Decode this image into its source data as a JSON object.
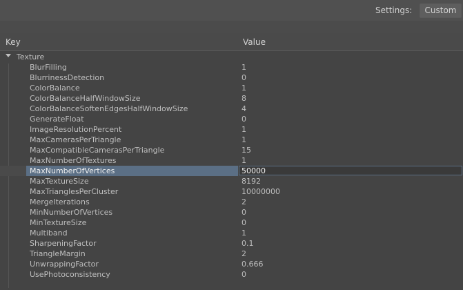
{
  "settings": {
    "label": "Settings:",
    "value": "Custom"
  },
  "columns": {
    "key": "Key",
    "value": "Value"
  },
  "group": {
    "label": "Texture"
  },
  "rows": [
    {
      "key": "BlurFilling",
      "value": "1"
    },
    {
      "key": "BlurrinessDetection",
      "value": "0"
    },
    {
      "key": "ColorBalance",
      "value": "1"
    },
    {
      "key": "ColorBalanceHalfWindowSize",
      "value": "8"
    },
    {
      "key": "ColorBalanceSoftenEdgesHalfWindowSize",
      "value": "4"
    },
    {
      "key": "GenerateFloat",
      "value": "0"
    },
    {
      "key": "ImageResolutionPercent",
      "value": "1"
    },
    {
      "key": "MaxCamerasPerTriangle",
      "value": "1"
    },
    {
      "key": "MaxCompatibleCamerasPerTriangle",
      "value": "15"
    },
    {
      "key": "MaxNumberOfTextures",
      "value": "1"
    },
    {
      "key": "MaxNumberOfVertices",
      "value": "50000",
      "selected": true
    },
    {
      "key": "MaxTextureSize",
      "value": "8192"
    },
    {
      "key": "MaxTrianglesPerCluster",
      "value": "10000000"
    },
    {
      "key": "MergeIterations",
      "value": "2"
    },
    {
      "key": "MinNumberOfVertices",
      "value": "0"
    },
    {
      "key": "MinTextureSize",
      "value": "0"
    },
    {
      "key": "Multiband",
      "value": "1"
    },
    {
      "key": "SharpeningFactor",
      "value": "0.1"
    },
    {
      "key": "TriangleMargin",
      "value": "2"
    },
    {
      "key": "UnwrappingFactor",
      "value": "0.666"
    },
    {
      "key": "UsePhotoconsistency",
      "value": "0"
    }
  ]
}
